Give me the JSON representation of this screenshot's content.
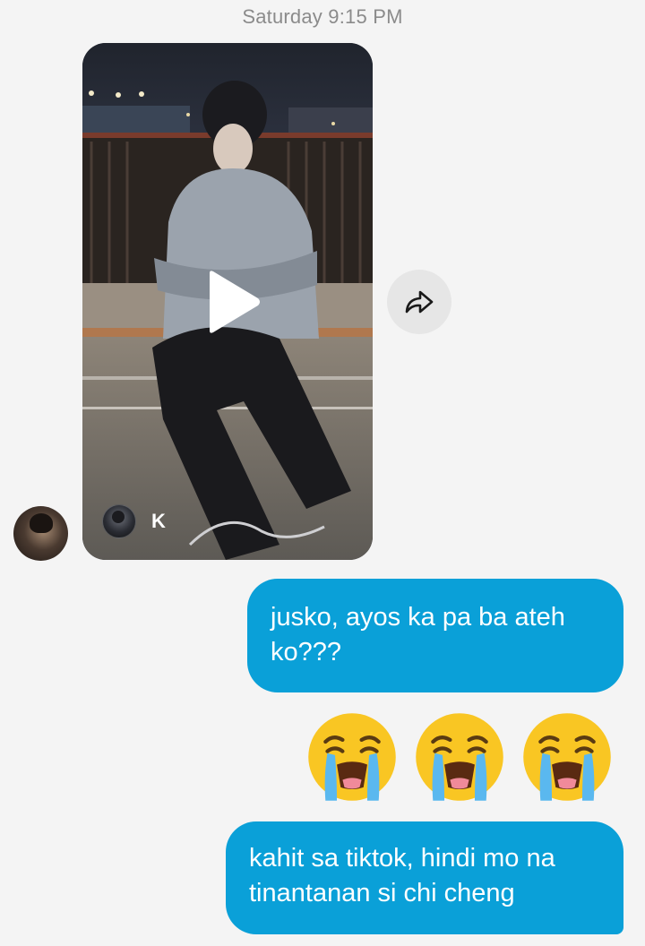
{
  "conversation": {
    "timestamp": "Saturday 9:15 PM"
  },
  "shared_video": {
    "author_initial": "K",
    "icons": {
      "play": "play-icon",
      "share": "share-arrow-icon"
    }
  },
  "messages": [
    {
      "from": "me",
      "text": "jusko, ayos ka pa ba ateh ko???"
    },
    {
      "from": "me",
      "emoji": [
        "loudly-crying-face",
        "loudly-crying-face",
        "loudly-crying-face"
      ]
    },
    {
      "from": "me",
      "text": "kahit sa tiktok, hindi mo na tinantanan si chi cheng"
    }
  ],
  "colors": {
    "background": "#f4f4f4",
    "bubble": "#0aa0d8",
    "timestamp": "#8b8b8b"
  }
}
